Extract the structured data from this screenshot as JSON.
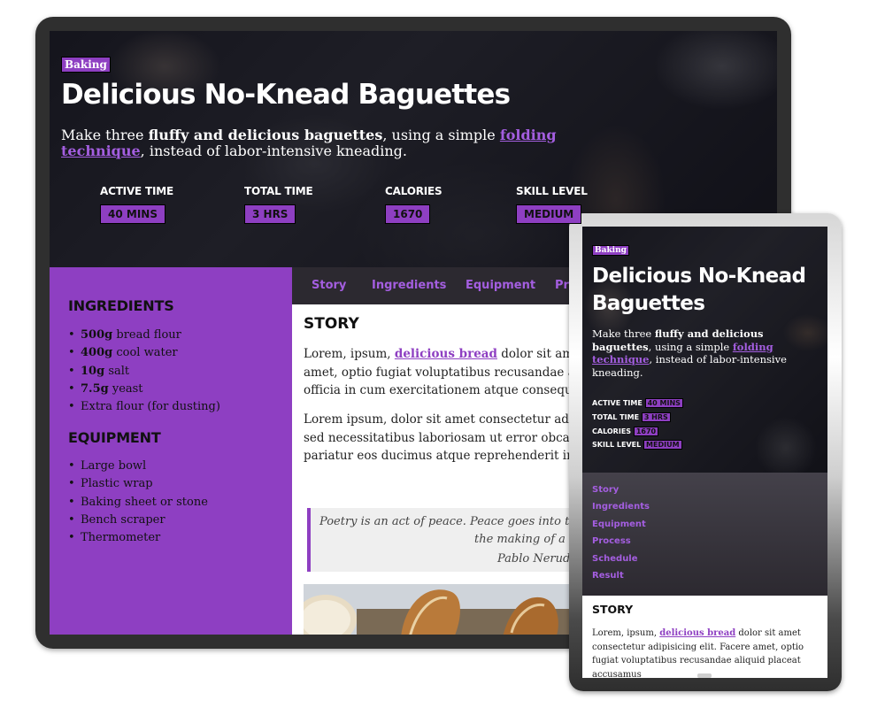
{
  "desktop": {
    "tag": "Baking",
    "title": "Delicious No-Knead Baguettes",
    "subtitle": {
      "pre": "Make three ",
      "bold": "fluffy and delicious baguettes",
      "mid": ", using a simple ",
      "link": "folding technique",
      "post": ", instead of labor-intensive kneading."
    },
    "stats": [
      {
        "label": "ACTIVE TIME",
        "value": "40 MINS"
      },
      {
        "label": "TOTAL TIME",
        "value": "3 HRS"
      },
      {
        "label": "CALORIES",
        "value": "1670"
      },
      {
        "label": "SKILL LEVEL",
        "value": "MEDIUM"
      }
    ],
    "ingredients_heading": "INGREDIENTS",
    "ingredients": [
      {
        "amount": "500g",
        "item": " bread flour"
      },
      {
        "amount": "400g",
        "item": " cool water"
      },
      {
        "amount": "10g",
        "item": " salt"
      },
      {
        "amount": "7.5g",
        "item": " yeast"
      },
      {
        "amount": "",
        "item": "Extra flour (for dusting)"
      }
    ],
    "equipment_heading": "EQUIPMENT",
    "equipment": [
      "Large bowl",
      "Plastic wrap",
      "Baking sheet or stone",
      "Bench scraper",
      "Thermometer"
    ],
    "tabs": [
      "Story",
      "Ingredients",
      "Equipment",
      "Pro"
    ],
    "story_heading": "STORY",
    "para1": {
      "line1_pre": "Lorem, ipsum, ",
      "line1_link": "delicious bread",
      "line1_post": " dolor sit amet co",
      "line2": "amet, optio fugiat voluptatibus recusandae aliquid",
      "line3": "officia in cum exercitationem atque consequuntur"
    },
    "para2": {
      "line1": "Lorem ipsum, dolor sit amet consectetur adipisicin",
      "line2": "sed necessitatibus laboriosam ut error obcaecati vo",
      "line3": "pariatur eos ducimus atque reprehenderit inventor"
    },
    "quote": {
      "line1": "Poetry is an act of peace. Peace goes into the m",
      "line2": "the making of a bi",
      "author": "Pablo Neruda"
    }
  },
  "tablet": {
    "tag": "Baking",
    "title": "Delicious No-Knead Baguettes",
    "subtitle": {
      "pre": "Make three ",
      "bold": "fluffy and delicious baguettes",
      "mid": ", using a simple ",
      "link": "folding technique",
      "post": ", instead of labor-intensive kneading."
    },
    "stats": [
      {
        "label": "ACTIVE TIME",
        "value": "40 MINS"
      },
      {
        "label": "TOTAL TIME",
        "value": "3 HRS"
      },
      {
        "label": "CALORIES",
        "value": "1670"
      },
      {
        "label": "SKILL LEVEL",
        "value": "MEDIUM"
      }
    ],
    "nav": [
      "Story",
      "Ingredients",
      "Equipment",
      "Process",
      "Schedule",
      "Result"
    ],
    "story_heading": "STORY",
    "para": {
      "pre": "Lorem, ipsum, ",
      "link": "delicious bread",
      "post": " dolor sit amet consectetur adipisicing elit. Facere amet, optio fugiat voluptatibus recusandae aliquid placeat accusamus"
    }
  },
  "colors": {
    "accent": "#8e3fc2",
    "link": "#a45ee0",
    "nav_bg": "#2c2930",
    "frame_dark": "#2f2f2f"
  }
}
